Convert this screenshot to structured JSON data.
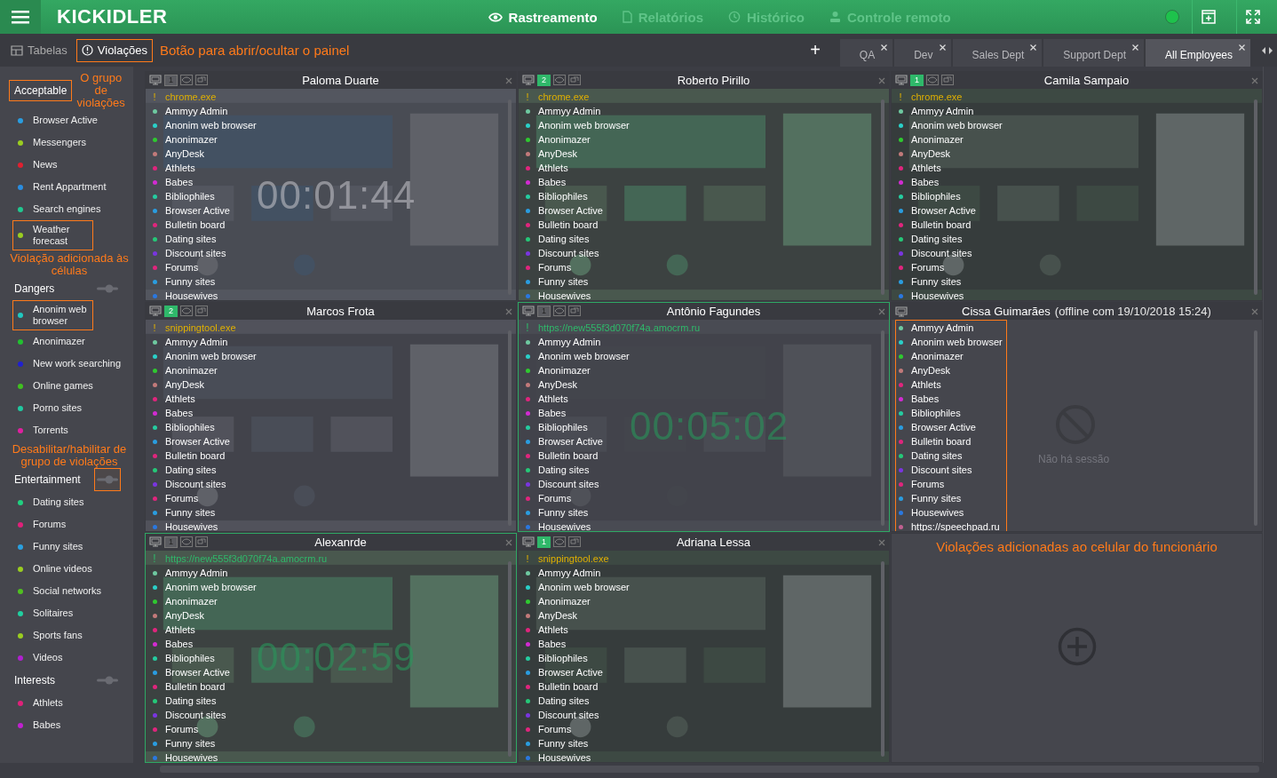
{
  "topbar": {
    "logo": "KICKIDLER",
    "nav": [
      {
        "label": "Rastreamento",
        "selected": true
      },
      {
        "label": "Relatórios",
        "selected": false
      },
      {
        "label": "Histórico",
        "selected": false
      },
      {
        "label": "Controle remoto",
        "selected": false
      }
    ]
  },
  "toolbar": {
    "views": [
      {
        "label": "Tabelas",
        "selected": false,
        "highlighted": false
      },
      {
        "label": "Violações",
        "selected": true,
        "highlighted": true
      }
    ],
    "note": "Botão para abrir/ocultar o painel",
    "add": "+",
    "tabs": [
      {
        "label": "QA",
        "selected": false
      },
      {
        "label": "Dev",
        "selected": false
      },
      {
        "label": "Sales Dept",
        "selected": false
      },
      {
        "label": "Support Dept",
        "selected": false
      },
      {
        "label": "All Employees",
        "selected": true
      }
    ]
  },
  "groups": [
    {
      "name": "Acceptable",
      "header_highlighted": true,
      "note": {
        "kind": "inline",
        "text": "O grupo de violações"
      },
      "items": [
        {
          "name": "Browser Active",
          "color": "#2a9de0",
          "highlighted": false
        },
        {
          "name": "Messengers",
          "color": "#9acd20",
          "highlighted": false
        },
        {
          "name": "News",
          "color": "#e02030",
          "highlighted": false
        },
        {
          "name": "Rent Appartment",
          "color": "#2a8de0",
          "highlighted": false
        },
        {
          "name": "Search engines",
          "color": "#20c890",
          "highlighted": false
        },
        {
          "name": "Weather forecast",
          "color": "#9acd20",
          "highlighted": true
        }
      ]
    },
    {
      "name": "Dangers",
      "header_highlighted": false,
      "toggle_highlighted": false,
      "note": {
        "kind": "above",
        "text": "Violação adicionada às células"
      },
      "items": [
        {
          "name": "Anonim web browser",
          "color": "#20c8c0",
          "highlighted": true
        },
        {
          "name": "Anonimazer",
          "color": "#22c030",
          "highlighted": false
        },
        {
          "name": "New work searching",
          "color": "#2020d0",
          "highlighted": false
        },
        {
          "name": "Online games",
          "color": "#40c020",
          "highlighted": false
        },
        {
          "name": "Porno sites",
          "color": "#20c8a0",
          "highlighted": false
        },
        {
          "name": "Torrents",
          "color": "#e020a0",
          "highlighted": false
        }
      ]
    },
    {
      "name": "Entertainment",
      "header_highlighted": false,
      "toggle_highlighted": true,
      "note": {
        "kind": "above",
        "text": "Desabilitar/habilitar de grupo de violações"
      },
      "items": [
        {
          "name": "Dating sites",
          "color": "#20d080",
          "highlighted": false
        },
        {
          "name": "Forums",
          "color": "#e0207a",
          "highlighted": false
        },
        {
          "name": "Funny sites",
          "color": "#2aa0e0",
          "highlighted": false
        },
        {
          "name": "Online videos",
          "color": "#9acd20",
          "highlighted": false
        },
        {
          "name": "Social networks",
          "color": "#50c020",
          "highlighted": false
        },
        {
          "name": "Solitaires",
          "color": "#20d0a0",
          "highlighted": false
        },
        {
          "name": "Sports fans",
          "color": "#9acd20",
          "highlighted": false
        },
        {
          "name": "Videos",
          "color": "#b020d0",
          "highlighted": false
        }
      ]
    },
    {
      "name": "Interests",
      "header_highlighted": false,
      "toggle_highlighted": false,
      "items": [
        {
          "name": "Athlets",
          "color": "#e0207a",
          "highlighted": false
        },
        {
          "name": "Babes",
          "color": "#c020d0",
          "highlighted": false
        }
      ]
    }
  ],
  "tiles": [
    {
      "kind": "session",
      "name": "Paloma Duarte",
      "screens": "1",
      "badge_active": false,
      "selected": false,
      "app": {
        "kind": "app",
        "mark": "!",
        "text": "chrome.exe"
      },
      "timer": "00:01:44",
      "list_highlighted": false,
      "violations": [
        {
          "name": "Ammyy Admin",
          "color": "#6ec9a0"
        },
        {
          "name": "Anonim web browser",
          "color": "#2ad0c8"
        },
        {
          "name": "Anonimazer",
          "color": "#2fc930"
        },
        {
          "name": "AnyDesk",
          "color": "#c27a7a"
        },
        {
          "name": "Athlets",
          "color": "#e0257d"
        },
        {
          "name": "Babes",
          "color": "#d22bd2"
        },
        {
          "name": "Bibliophiles",
          "color": "#25cca0"
        },
        {
          "name": "Browser Active",
          "color": "#2a9de0"
        },
        {
          "name": "Bulletin board",
          "color": "#e0257d"
        },
        {
          "name": "Dating sites",
          "color": "#25c878"
        },
        {
          "name": "Discount sites",
          "color": "#7a35e0"
        },
        {
          "name": "Forums",
          "color": "#e0257d"
        },
        {
          "name": "Funny sites",
          "color": "#2a9de0"
        },
        {
          "name": "Housewives",
          "color": "#2a78e0"
        }
      ]
    },
    {
      "kind": "session",
      "name": "Roberto Pirillo",
      "screens": "2",
      "badge_active": true,
      "selected": false,
      "app": {
        "kind": "app",
        "mark": "!",
        "text": "chrome.exe"
      },
      "list_highlighted": false,
      "violations": [
        {
          "name": "Ammyy Admin",
          "color": "#6ec9a0"
        },
        {
          "name": "Anonim web browser",
          "color": "#2ad0c8"
        },
        {
          "name": "Anonimazer",
          "color": "#2fc930"
        },
        {
          "name": "AnyDesk",
          "color": "#c27a7a"
        },
        {
          "name": "Athlets",
          "color": "#e0257d"
        },
        {
          "name": "Babes",
          "color": "#d22bd2"
        },
        {
          "name": "Bibliophiles",
          "color": "#25cca0"
        },
        {
          "name": "Browser Active",
          "color": "#2a9de0"
        },
        {
          "name": "Bulletin board",
          "color": "#e0257d"
        },
        {
          "name": "Dating sites",
          "color": "#25c878"
        },
        {
          "name": "Discount sites",
          "color": "#7a35e0"
        },
        {
          "name": "Forums",
          "color": "#e0257d"
        },
        {
          "name": "Funny sites",
          "color": "#2a9de0"
        },
        {
          "name": "Housewives",
          "color": "#2a78e0"
        }
      ]
    },
    {
      "kind": "session",
      "name": "Camila Sampaio",
      "screens": "1",
      "badge_active": true,
      "selected": false,
      "app": {
        "kind": "app",
        "mark": "!",
        "text": "chrome.exe"
      },
      "list_highlighted": false,
      "violations": [
        {
          "name": "Ammyy Admin",
          "color": "#6ec9a0"
        },
        {
          "name": "Anonim web browser",
          "color": "#2ad0c8"
        },
        {
          "name": "Anonimazer",
          "color": "#2fc930"
        },
        {
          "name": "AnyDesk",
          "color": "#c27a7a"
        },
        {
          "name": "Athlets",
          "color": "#e0257d"
        },
        {
          "name": "Babes",
          "color": "#d22bd2"
        },
        {
          "name": "Bibliophiles",
          "color": "#25cca0"
        },
        {
          "name": "Browser Active",
          "color": "#2a9de0"
        },
        {
          "name": "Bulletin board",
          "color": "#e0257d"
        },
        {
          "name": "Dating sites",
          "color": "#25c878"
        },
        {
          "name": "Discount sites",
          "color": "#7a35e0"
        },
        {
          "name": "Forums",
          "color": "#e0257d"
        },
        {
          "name": "Funny sites",
          "color": "#2a9de0"
        },
        {
          "name": "Housewives",
          "color": "#2a78e0"
        }
      ]
    },
    {
      "kind": "session",
      "name": "Marcos Frota",
      "screens": "2",
      "badge_active": true,
      "selected": false,
      "app": {
        "kind": "app",
        "mark": "!",
        "text": "snippingtool.exe"
      },
      "list_highlighted": false,
      "violations": [
        {
          "name": "Ammyy Admin",
          "color": "#6ec9a0"
        },
        {
          "name": "Anonim web browser",
          "color": "#2ad0c8"
        },
        {
          "name": "Anonimazer",
          "color": "#2fc930"
        },
        {
          "name": "AnyDesk",
          "color": "#c27a7a"
        },
        {
          "name": "Athlets",
          "color": "#e0257d"
        },
        {
          "name": "Babes",
          "color": "#d22bd2"
        },
        {
          "name": "Bibliophiles",
          "color": "#25cca0"
        },
        {
          "name": "Browser Active",
          "color": "#2a9de0"
        },
        {
          "name": "Bulletin board",
          "color": "#e0257d"
        },
        {
          "name": "Dating sites",
          "color": "#25c878"
        },
        {
          "name": "Discount sites",
          "color": "#7a35e0"
        },
        {
          "name": "Forums",
          "color": "#e0257d"
        },
        {
          "name": "Funny sites",
          "color": "#2a9de0"
        },
        {
          "name": "Housewives",
          "color": "#2a78e0"
        }
      ]
    },
    {
      "kind": "session",
      "name": "Antônio Fagundes",
      "screens": "1",
      "badge_active": false,
      "selected": true,
      "app": {
        "kind": "url",
        "mark": "!",
        "text": "https://new555f3d070f74a.amocrm.ru"
      },
      "timer": "00:05:02",
      "list_highlighted": false,
      "violations": [
        {
          "name": "Ammyy Admin",
          "color": "#6ec9a0"
        },
        {
          "name": "Anonim web browser",
          "color": "#2ad0c8"
        },
        {
          "name": "Anonimazer",
          "color": "#2fc930"
        },
        {
          "name": "AnyDesk",
          "color": "#c27a7a"
        },
        {
          "name": "Athlets",
          "color": "#e0257d"
        },
        {
          "name": "Babes",
          "color": "#d22bd2"
        },
        {
          "name": "Bibliophiles",
          "color": "#25cca0"
        },
        {
          "name": "Browser Active",
          "color": "#2a9de0"
        },
        {
          "name": "Bulletin board",
          "color": "#e0257d"
        },
        {
          "name": "Dating sites",
          "color": "#25c878"
        },
        {
          "name": "Discount sites",
          "color": "#7a35e0"
        },
        {
          "name": "Forums",
          "color": "#e0257d"
        },
        {
          "name": "Funny sites",
          "color": "#2a9de0"
        },
        {
          "name": "Housewives",
          "color": "#2a78e0"
        }
      ]
    },
    {
      "kind": "offline",
      "name": "Cissa Guimarães",
      "note": "(offline com 19/10/2018 15:24)",
      "empty_text": "Não há sessão",
      "list_highlighted": true,
      "violations": [
        {
          "name": "Ammyy Admin",
          "color": "#6ec9a0"
        },
        {
          "name": "Anonim web browser",
          "color": "#2ad0c8"
        },
        {
          "name": "Anonimazer",
          "color": "#2fc930"
        },
        {
          "name": "AnyDesk",
          "color": "#c27a7a"
        },
        {
          "name": "Athlets",
          "color": "#e0257d"
        },
        {
          "name": "Babes",
          "color": "#d22bd2"
        },
        {
          "name": "Bibliophiles",
          "color": "#25cca0"
        },
        {
          "name": "Browser Active",
          "color": "#2a9de0"
        },
        {
          "name": "Bulletin board",
          "color": "#e0257d"
        },
        {
          "name": "Dating sites",
          "color": "#25c878"
        },
        {
          "name": "Discount sites",
          "color": "#7a35e0"
        },
        {
          "name": "Forums",
          "color": "#e0257d"
        },
        {
          "name": "Funny sites",
          "color": "#2a9de0"
        },
        {
          "name": "Housewives",
          "color": "#2a78e0"
        },
        {
          "name": "https://speechpad.ru",
          "color": "#c06090"
        }
      ]
    },
    {
      "kind": "session",
      "name": "Alexanrde",
      "screens": "1",
      "badge_active": false,
      "selected": true,
      "app": {
        "kind": "url",
        "mark": "!",
        "text": "https://new555f3d070f74a.amocrm.ru"
      },
      "timer": "00:02:59",
      "list_highlighted": false,
      "violations": [
        {
          "name": "Ammyy Admin",
          "color": "#6ec9a0"
        },
        {
          "name": "Anonim web browser",
          "color": "#2ad0c8"
        },
        {
          "name": "Anonimazer",
          "color": "#2fc930"
        },
        {
          "name": "AnyDesk",
          "color": "#c27a7a"
        },
        {
          "name": "Athlets",
          "color": "#e0257d"
        },
        {
          "name": "Babes",
          "color": "#d22bd2"
        },
        {
          "name": "Bibliophiles",
          "color": "#25cca0"
        },
        {
          "name": "Browser Active",
          "color": "#2a9de0"
        },
        {
          "name": "Bulletin board",
          "color": "#e0257d"
        },
        {
          "name": "Dating sites",
          "color": "#25c878"
        },
        {
          "name": "Discount sites",
          "color": "#7a35e0"
        },
        {
          "name": "Forums",
          "color": "#e0257d"
        },
        {
          "name": "Funny sites",
          "color": "#2a9de0"
        },
        {
          "name": "Housewives",
          "color": "#2a78e0"
        }
      ]
    },
    {
      "kind": "session",
      "name": "Adriana Lessa",
      "screens": "1",
      "badge_active": true,
      "selected": false,
      "app": {
        "kind": "app",
        "mark": "!",
        "text": "snippingtool.exe"
      },
      "list_highlighted": false,
      "violations": [
        {
          "name": "Ammyy Admin",
          "color": "#6ec9a0"
        },
        {
          "name": "Anonim web browser",
          "color": "#2ad0c8"
        },
        {
          "name": "Anonimazer",
          "color": "#2fc930"
        },
        {
          "name": "AnyDesk",
          "color": "#c27a7a"
        },
        {
          "name": "Athlets",
          "color": "#e0257d"
        },
        {
          "name": "Babes",
          "color": "#d22bd2"
        },
        {
          "name": "Bibliophiles",
          "color": "#25cca0"
        },
        {
          "name": "Browser Active",
          "color": "#2a9de0"
        },
        {
          "name": "Bulletin board",
          "color": "#e0257d"
        },
        {
          "name": "Dating sites",
          "color": "#25c878"
        },
        {
          "name": "Discount sites",
          "color": "#7a35e0"
        },
        {
          "name": "Forums",
          "color": "#e0257d"
        },
        {
          "name": "Funny sites",
          "color": "#2a9de0"
        },
        {
          "name": "Housewives",
          "color": "#2a78e0"
        }
      ]
    },
    {
      "kind": "add",
      "caption": "Violações adicionadas ao celular do funcionário"
    }
  ]
}
